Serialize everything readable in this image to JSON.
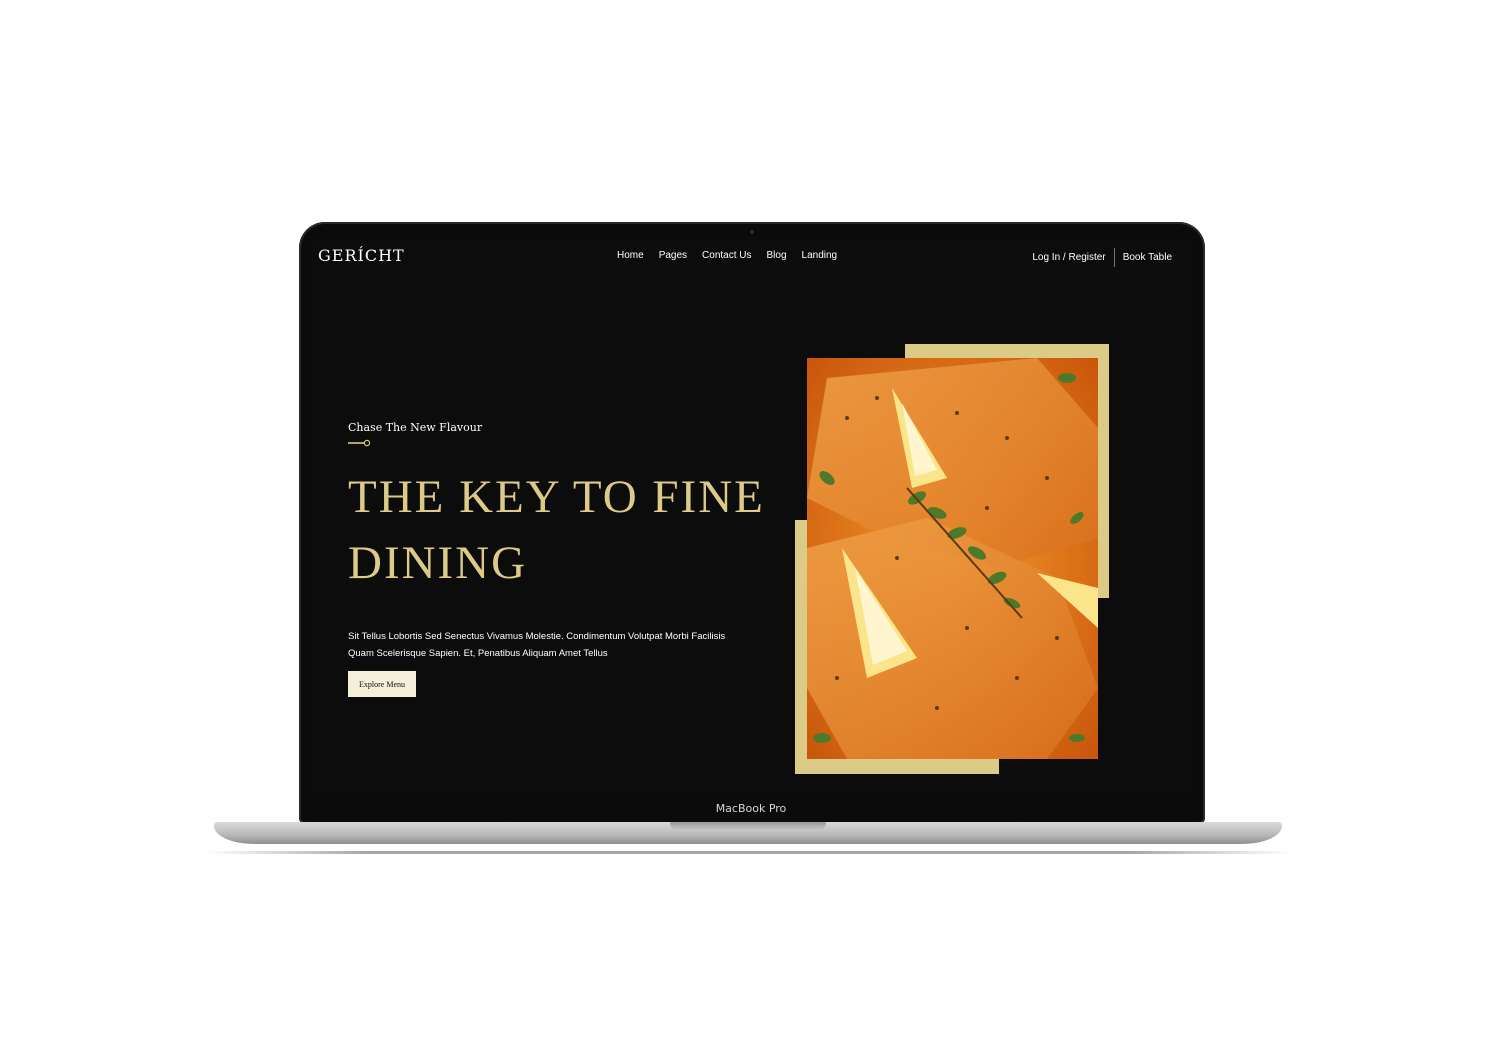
{
  "device": {
    "label": "MacBook Pro"
  },
  "brand": {
    "logo": "GERÍCHT",
    "gold": "#dcca87",
    "cream": "#f5efdb",
    "background": "#0c0c0c"
  },
  "nav": {
    "links": [
      "Home",
      "Pages",
      "Contact Us",
      "Blog",
      "Landing"
    ],
    "login": "Log In / Register",
    "book": "Book Table"
  },
  "hero": {
    "subtitle": "Chase The New Flavour",
    "title": "THE KEY TO FINE DINING",
    "description": "Sit Tellus Lobortis Sed Senectus Vivamus Molestie. Condimentum Volutpat Morbi Facilisis Quam Scelerisque Sapien. Et, Penatibus Aliquam Amet Tellus",
    "cta": "Explore Menu"
  }
}
